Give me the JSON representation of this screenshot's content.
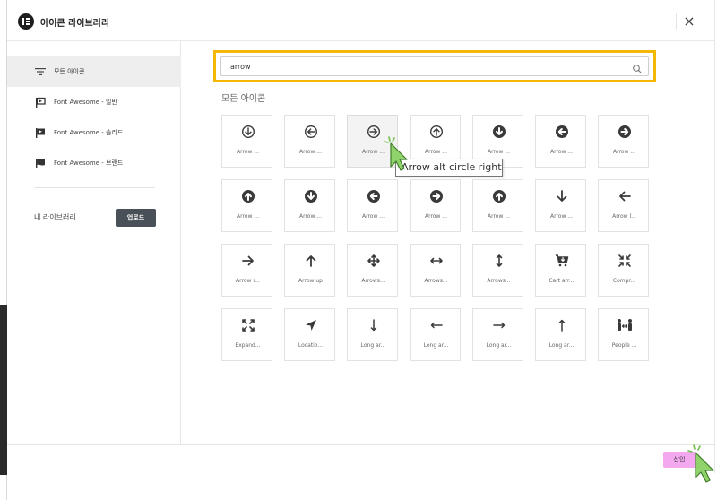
{
  "window": {
    "title": "아이콘 라이브러리",
    "close_glyph": "×"
  },
  "sidebar": {
    "items": [
      {
        "label": "모든 아이콘",
        "icon": "menu-lines-icon",
        "active": true
      },
      {
        "label": "Font Awesome - 일반",
        "icon": "flag-outline-icon",
        "active": false
      },
      {
        "label": "Font Awesome - 솔리드",
        "icon": "flag-solid-icon",
        "active": false
      },
      {
        "label": "Font Awesome - 브랜드",
        "icon": "flag-brand-icon",
        "active": false
      }
    ],
    "my_library_label": "내 라이브러리",
    "upload_label": "업로드"
  },
  "search": {
    "value": "arrow",
    "placeholder": ""
  },
  "section_title": "모든 아이콘",
  "icons": [
    {
      "label": "Arrow ...",
      "icon": "arrow-alt-circle-down-icon"
    },
    {
      "label": "Arrow ...",
      "icon": "arrow-alt-circle-left-icon"
    },
    {
      "label": "Arrow ...",
      "icon": "arrow-alt-circle-right-icon"
    },
    {
      "label": "Arrow ...",
      "icon": "arrow-alt-circle-up-icon"
    },
    {
      "label": "Arrow ...",
      "icon": "arrow-circle-down-icon"
    },
    {
      "label": "Arrow ...",
      "icon": "arrow-circle-left-icon"
    },
    {
      "label": "Arrow ...",
      "icon": "arrow-circle-right-icon"
    },
    {
      "label": "Arrow ...",
      "icon": "arrow-circle-up-icon"
    },
    {
      "label": "Arrow ...",
      "icon": "arrow-circle-down-icon"
    },
    {
      "label": "Arrow ...",
      "icon": "arrow-circle-left-icon"
    },
    {
      "label": "Arrow ...",
      "icon": "arrow-circle-right-icon"
    },
    {
      "label": "Arrow ...",
      "icon": "arrow-circle-up-icon"
    },
    {
      "label": "Arrow ...",
      "icon": "arrow-down-icon"
    },
    {
      "label": "Arrow l...",
      "icon": "arrow-left-icon"
    },
    {
      "label": "Arrow r...",
      "icon": "arrow-right-icon"
    },
    {
      "label": "Arrow up",
      "icon": "arrow-up-icon"
    },
    {
      "label": "Arrows...",
      "icon": "arrows-move-icon"
    },
    {
      "label": "Arrows...",
      "icon": "arrows-horizontal-icon"
    },
    {
      "label": "Arrows...",
      "icon": "arrows-vertical-icon"
    },
    {
      "label": "Cart arr...",
      "icon": "cart-arrow-down-icon"
    },
    {
      "label": "Compr...",
      "icon": "compress-arrows-icon"
    },
    {
      "label": "Expand...",
      "icon": "expand-arrows-icon"
    },
    {
      "label": "Locatio...",
      "icon": "location-arrow-icon"
    },
    {
      "label": "Long ar...",
      "icon": "long-arrow-down-icon"
    },
    {
      "label": "Long ar...",
      "icon": "long-arrow-left-icon"
    },
    {
      "label": "Long ar...",
      "icon": "long-arrow-right-icon"
    },
    {
      "label": "Long ar...",
      "icon": "long-arrow-up-icon"
    },
    {
      "label": "People ...",
      "icon": "people-arrows-icon"
    }
  ],
  "hovered_index": 2,
  "tooltip": "Arrow alt circle right",
  "footer": {
    "insert_label": "삽입"
  },
  "colors": {
    "highlight": "#f2b805",
    "insert_button": "#f3a8f0",
    "upload_button": "#4a5057",
    "cursor": "#7ec45a"
  }
}
